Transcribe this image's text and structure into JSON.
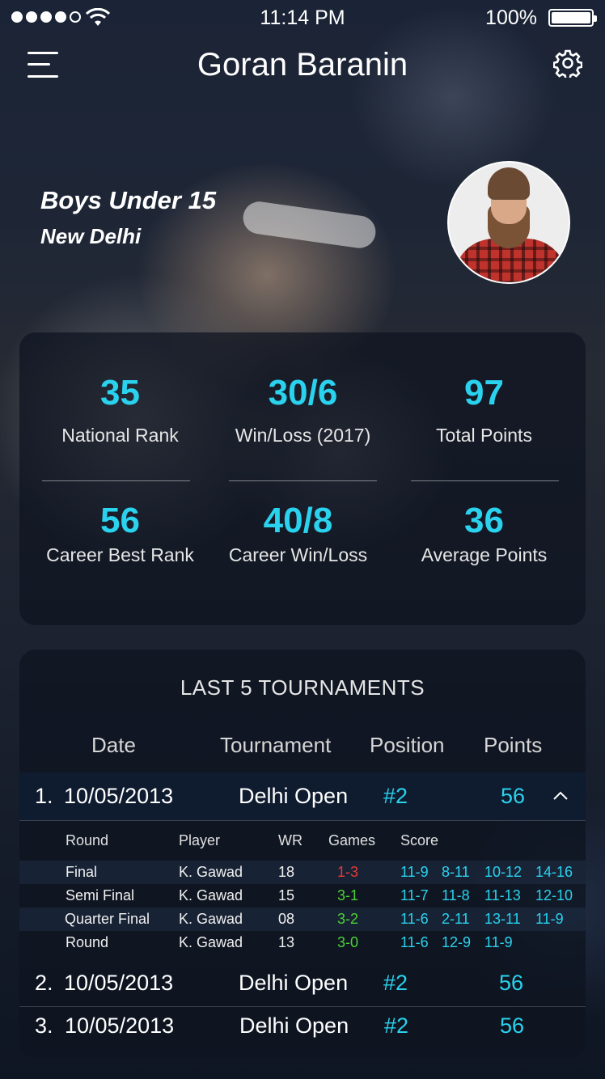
{
  "status_bar": {
    "time": "11:14 PM",
    "battery": "100%"
  },
  "header": {
    "title": "Goran Baranin"
  },
  "profile": {
    "category": "Boys Under 15",
    "city": "New Delhi"
  },
  "stats": [
    {
      "value": "35",
      "label": "National Rank"
    },
    {
      "value": "30/6",
      "label": "Win/Loss (2017)"
    },
    {
      "value": "97",
      "label": "Total Points"
    },
    {
      "value": "56",
      "label": "Career Best Rank"
    },
    {
      "value": "40/8",
      "label": "Career Win/Loss"
    },
    {
      "value": "36",
      "label": "Average Points"
    }
  ],
  "tournaments": {
    "title": "LAST 5 TOURNAMENTS",
    "columns": [
      "Date",
      "Tournament",
      "Position",
      "Points"
    ],
    "rows": [
      {
        "num": "1.",
        "date": "10/05/2013",
        "name": "Delhi Open",
        "position": "#2",
        "points": "56"
      },
      {
        "num": "2.",
        "date": "10/05/2013",
        "name": "Delhi Open",
        "position": "#2",
        "points": "56"
      },
      {
        "num": "3.",
        "date": "10/05/2013",
        "name": "Delhi Open",
        "position": "#2",
        "points": "56"
      }
    ],
    "detail": {
      "columns": [
        "Round",
        "Player",
        "WR",
        "Games",
        "Score"
      ],
      "rows": [
        {
          "round": "Final",
          "player": "K. Gawad",
          "wr": "18",
          "games": "1-3",
          "result": "loss",
          "scores": [
            "11-9",
            "8-11",
            "10-12",
            "14-16"
          ]
        },
        {
          "round": "Semi Final",
          "player": "K. Gawad",
          "wr": "15",
          "games": "3-1",
          "result": "win",
          "scores": [
            "11-7",
            "11-8",
            "11-13",
            "12-10"
          ]
        },
        {
          "round": "Quarter Final",
          "player": "K. Gawad",
          "wr": "08",
          "games": "3-2",
          "result": "win",
          "scores": [
            "11-6",
            "2-11",
            "13-11",
            "11-9"
          ]
        },
        {
          "round": "Round",
          "player": "K. Gawad",
          "wr": "13",
          "games": "3-0",
          "result": "win",
          "scores": [
            "11-6",
            "12-9",
            "11-9"
          ]
        }
      ]
    }
  },
  "colors": {
    "accent": "#2ad2ee",
    "win": "#4cd137",
    "loss": "#e53935"
  }
}
